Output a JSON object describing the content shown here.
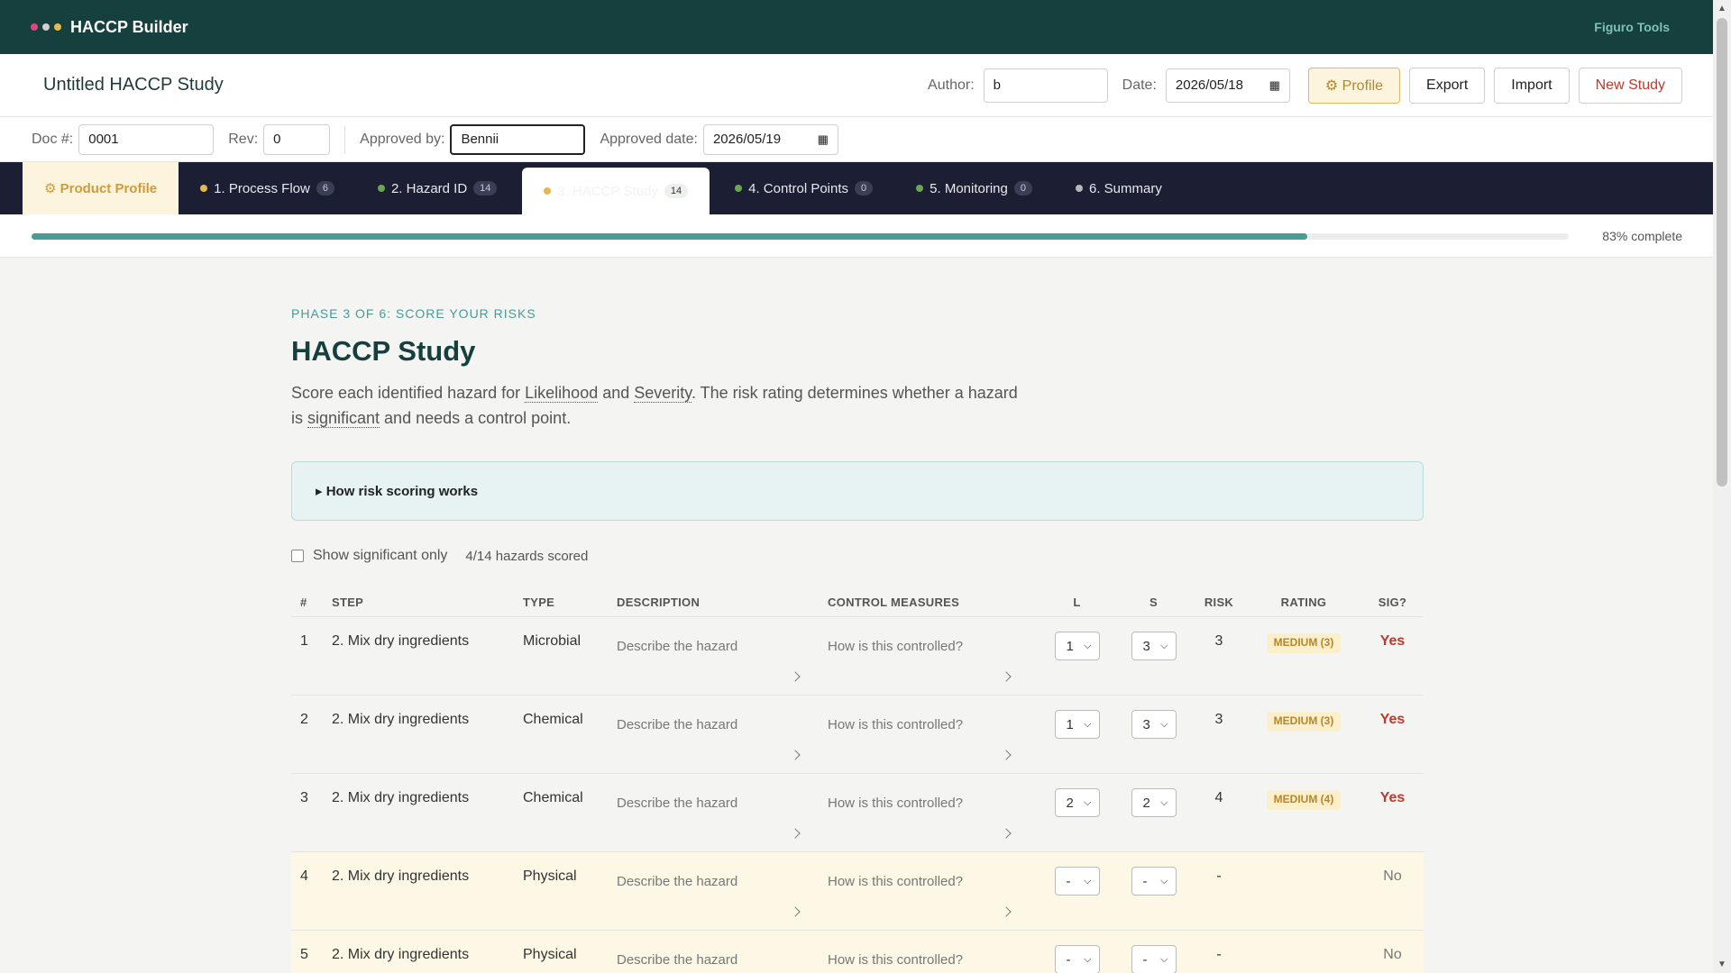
{
  "app": {
    "title": "HACCP Builder",
    "tools_link": "Figuro Tools",
    "dot_colors": [
      "#e0457b",
      "#d0d0d0",
      "#e7b84a"
    ]
  },
  "study": {
    "title": "Untitled HACCP Study",
    "author_label": "Author:",
    "author_value": "b",
    "date_label": "Date:",
    "date_value": "2026/05/18",
    "buttons": {
      "profile": "⚙ Profile",
      "export": "Export",
      "import": "Import",
      "new_study": "New Study"
    }
  },
  "doc": {
    "doc_label": "Doc #:",
    "doc_value": "0001",
    "rev_label": "Rev:",
    "rev_value": "0",
    "approved_by_label": "Approved by:",
    "approved_by_value": "Bennii",
    "approved_date_label": "Approved date:",
    "approved_date_value": "2026/05/19"
  },
  "tabs": [
    {
      "label": "⚙ Product Profile",
      "count": "",
      "color": ""
    },
    {
      "label": "1. Process Flow",
      "count": "6",
      "color": "#e7b84a"
    },
    {
      "label": "2. Hazard ID",
      "count": "14",
      "color": "#6aa84f"
    },
    {
      "label": "3. HACCP Study",
      "count": "14",
      "color": "#e7b84a"
    },
    {
      "label": "4. Control Points",
      "count": "0",
      "color": "#6aa84f"
    },
    {
      "label": "5. Monitoring",
      "count": "0",
      "color": "#6aa84f"
    },
    {
      "label": "6. Summary",
      "count": "",
      "color": "#b8b8b8"
    }
  ],
  "progress": {
    "label": "83% complete",
    "fraction": 0.83
  },
  "page": {
    "eyebrow": "PHASE 3 OF 6: SCORE YOUR RISKS",
    "title": "HACCP Study",
    "intro_1": "Score each identified hazard for ",
    "term_likelihood": "Likelihood",
    "intro_and": " and ",
    "term_severity": "Severity",
    "intro_2": ". The risk rating determines whether a hazard is ",
    "term_significant": "significant",
    "intro_3": " and needs a control point.",
    "info_toggle": "▸ How risk scoring works",
    "filter_label": "Show significant only",
    "scored_count": "4/14 hazards scored"
  },
  "table": {
    "headers": {
      "num": "#",
      "step": "STEP",
      "type": "TYPE",
      "desc": "DESCRIPTION",
      "ctrl": "CONTROL MEASURES",
      "l": "L",
      "s": "S",
      "risk": "RISK",
      "rating": "RATING",
      "sig": "SIG?"
    },
    "desc_placeholder": "Describe the hazard",
    "ctrl_placeholder": "How is this controlled?",
    "rows": [
      {
        "num": "1",
        "step": "2. Mix dry ingredients",
        "type": "Microbial",
        "l": "1",
        "s": "3",
        "risk": "3",
        "rating": "MEDIUM (3)",
        "sig": "Yes"
      },
      {
        "num": "2",
        "step": "2. Mix dry ingredients",
        "type": "Chemical",
        "l": "1",
        "s": "3",
        "risk": "3",
        "rating": "MEDIUM (3)",
        "sig": "Yes"
      },
      {
        "num": "3",
        "step": "2. Mix dry ingredients",
        "type": "Chemical",
        "l": "2",
        "s": "2",
        "risk": "4",
        "rating": "MEDIUM (4)",
        "sig": "Yes"
      },
      {
        "num": "4",
        "step": "2. Mix dry ingredients",
        "type": "Physical",
        "l": "-",
        "s": "-",
        "risk": "-",
        "rating": "",
        "sig": "No"
      },
      {
        "num": "5",
        "step": "2. Mix dry ingredients",
        "type": "Physical",
        "l": "-",
        "s": "-",
        "risk": "-",
        "rating": "",
        "sig": "No"
      }
    ]
  }
}
